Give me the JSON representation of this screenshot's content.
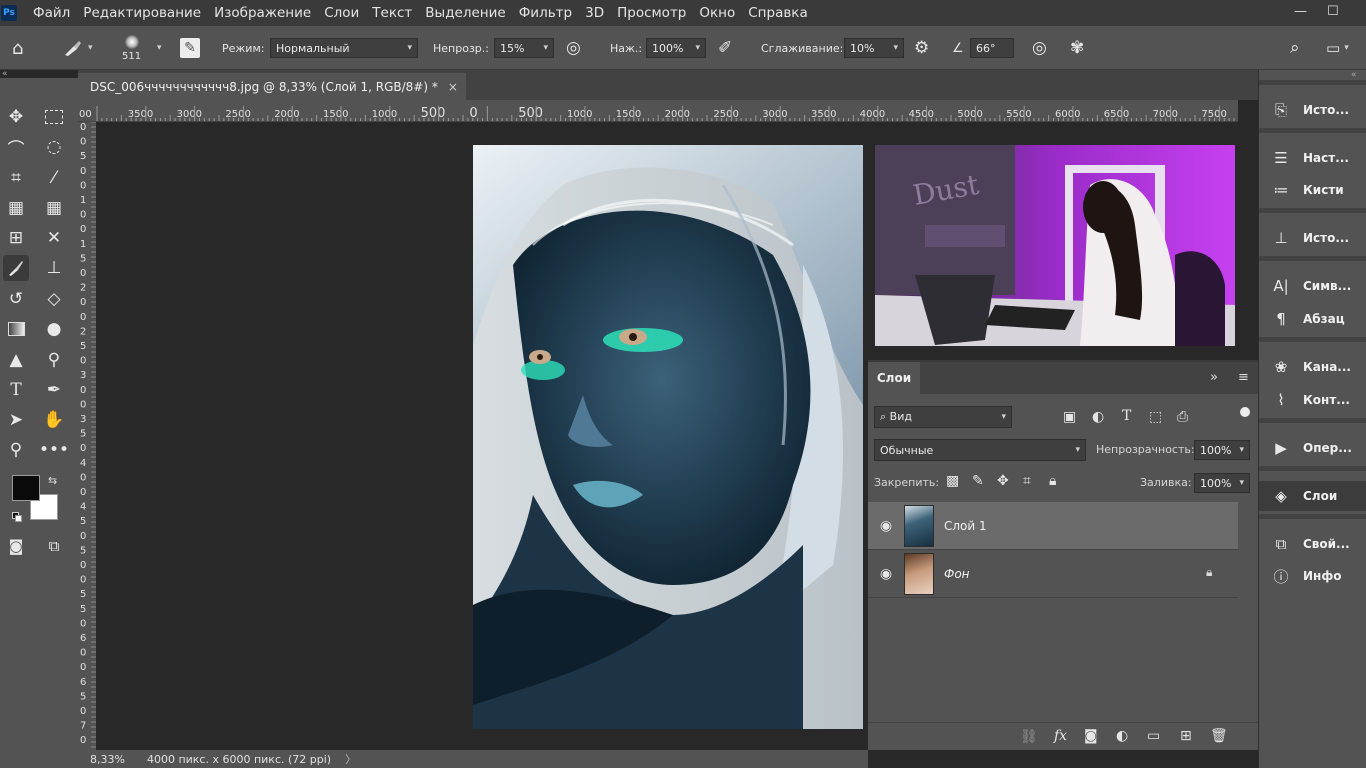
{
  "app": {
    "logo": "Ps"
  },
  "menu": [
    "Файл",
    "Редактирование",
    "Изображение",
    "Слои",
    "Текст",
    "Выделение",
    "Фильтр",
    "3D",
    "Просмотр",
    "Окно",
    "Справка"
  ],
  "window_controls": {
    "minimize": "—",
    "maximize": "☐"
  },
  "options": {
    "brush_size": "511",
    "mode_label": "Режим:",
    "mode_value": "Нормальный",
    "opacity_label": "Непрозр.:",
    "opacity_value": "15%",
    "pressure_label": "Наж.:",
    "pressure_value": "100%",
    "smoothing_label": "Сглаживание:",
    "smoothing_value": "10%",
    "angle_value": "66°"
  },
  "document": {
    "tab_title": "DSC_006чччччччччччч8.jpg @ 8,33% (Слой 1, RGB/8#) *",
    "close": "×",
    "zoom": "8,33%",
    "size_info": "4000 пикс. x 6000 пикс. (72 ppi)",
    "status_arrow": "〉"
  },
  "ruler_top": [
    "00",
    "3500",
    "3000",
    "2500",
    "2000",
    "1500",
    "1000",
    "500",
    "0",
    "500",
    "1000",
    "1500",
    "2000",
    "2500",
    "3000",
    "3500",
    "4000",
    "4500",
    "5000",
    "5500",
    "6000",
    "6500",
    "7000",
    "7500"
  ],
  "ruler_left": [
    "0",
    "0",
    "5",
    "0",
    "0",
    "1",
    "0",
    "0",
    "1",
    "5",
    "0",
    "2",
    "0",
    "0",
    "2",
    "5",
    "0",
    "3",
    "0",
    "0",
    "3",
    "5",
    "0",
    "4",
    "0",
    "0",
    "4",
    "5",
    "0",
    "5",
    "0",
    "0",
    "5",
    "5",
    "0",
    "6",
    "0",
    "0",
    "6",
    "5",
    "0",
    "7",
    "0"
  ],
  "right_panels": [
    {
      "icon": "history-icon",
      "label": "Исто..."
    },
    {
      "icon": "brush-settings-icon",
      "label": "Наст..."
    },
    {
      "icon": "brushes-icon",
      "label": "Кисти"
    },
    {
      "icon": "clone-source-icon",
      "label": "Исто..."
    },
    {
      "icon": "character-icon",
      "label": "Симв..."
    },
    {
      "icon": "paragraph-icon",
      "label": "Абзац"
    },
    {
      "icon": "channels-icon",
      "label": "Кана..."
    },
    {
      "icon": "paths-icon",
      "label": "Конт..."
    },
    {
      "icon": "actions-icon",
      "label": "Опер..."
    },
    {
      "icon": "layers-icon",
      "label": "Слои"
    },
    {
      "icon": "properties-icon",
      "label": "Свой..."
    },
    {
      "icon": "info-icon",
      "label": "Инфо"
    }
  ],
  "layers_panel": {
    "tab": "Слои",
    "filter_kind": "Вид",
    "blend_mode": "Обычные",
    "opacity_label": "Непрозрачность:",
    "opacity_value": "100%",
    "lock_label": "Закрепить:",
    "fill_label": "Заливка:",
    "fill_value": "100%",
    "layers": [
      {
        "name": "Слой 1",
        "visible": true,
        "selected": true
      },
      {
        "name": "Фон",
        "visible": true,
        "locked": true
      }
    ]
  },
  "colors": {
    "foreground": "#0a0a0a",
    "background": "#ffffff",
    "accent_purple": "#b020e0",
    "inverted_tint": "#5b8aa8"
  }
}
